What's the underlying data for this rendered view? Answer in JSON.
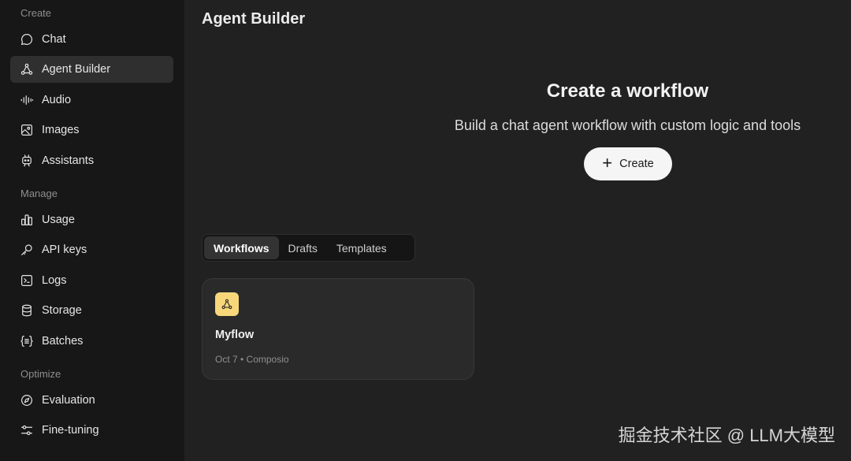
{
  "sidebar": {
    "sections": [
      {
        "label": "Create"
      },
      {
        "label": "Manage"
      },
      {
        "label": "Optimize"
      }
    ],
    "items": [
      {
        "label": "Chat",
        "icon": "chat-bubble-icon"
      },
      {
        "label": "Agent Builder",
        "icon": "agent-builder-icon",
        "active": true
      },
      {
        "label": "Audio",
        "icon": "waveform-icon"
      },
      {
        "label": "Images",
        "icon": "image-icon"
      },
      {
        "label": "Assistants",
        "icon": "robot-icon"
      },
      {
        "label": "Usage",
        "icon": "bar-chart-icon"
      },
      {
        "label": "API keys",
        "icon": "key-icon"
      },
      {
        "label": "Logs",
        "icon": "terminal-icon"
      },
      {
        "label": "Storage",
        "icon": "database-icon"
      },
      {
        "label": "Batches",
        "icon": "braces-list-icon"
      },
      {
        "label": "Evaluation",
        "icon": "compass-icon"
      },
      {
        "label": "Fine-tuning",
        "icon": "sliders-icon"
      }
    ]
  },
  "header": {
    "title": "Agent Builder"
  },
  "hero": {
    "title": "Create a workflow",
    "subtitle": "Build a chat agent workflow with custom logic and tools",
    "create_label": "Create"
  },
  "tabs": [
    {
      "label": "Workflows",
      "active": true
    },
    {
      "label": "Drafts"
    },
    {
      "label": "Templates"
    }
  ],
  "workflows": [
    {
      "title": "Myflow",
      "meta": "Oct 7 • Composio",
      "icon": "workflow-icon",
      "icon_bg": "#f7d77a"
    }
  ],
  "watermark": "掘金技术社区 @ LLM大模型"
}
